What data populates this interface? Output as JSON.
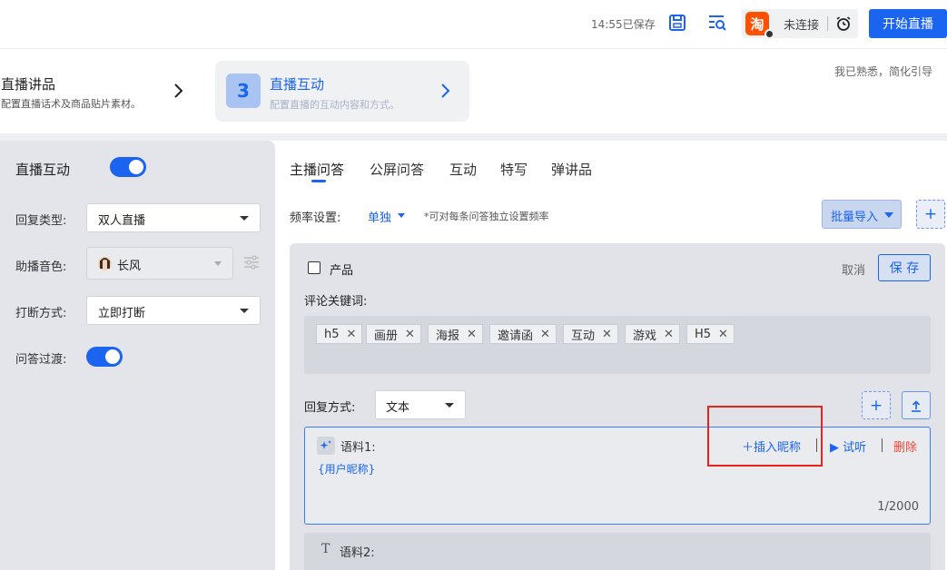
{
  "header": {
    "saved_status": "14:55已保存",
    "connection_platform": "淘",
    "connection_status": "未连接",
    "start_button": "开始直播"
  },
  "steps": {
    "step1_title": "直播讲品",
    "step1_desc": "配置直播话术及商品贴片素材。",
    "step2_number": "3",
    "step2_title": "直播互动",
    "step2_desc": "配置直播的互动内容和方式。",
    "familiar_link": "我已熟悉，简化引导"
  },
  "left_panel": {
    "main_label": "直播互动",
    "main_toggle": "on",
    "reply_type_label": "回复类型:",
    "reply_type_value": "双人直播",
    "voice_label": "助播音色:",
    "voice_value": "长风",
    "interrupt_label": "打断方式:",
    "interrupt_value": "立即打断",
    "qa_transition_label": "问答过渡:",
    "qa_transition_toggle": "on"
  },
  "tabs": [
    "主播问答",
    "公屏问答",
    "互动",
    "特写",
    "弹讲品"
  ],
  "active_tab": "主播问答",
  "frequency": {
    "label": "频率设置:",
    "value": "单独",
    "note": "*可对每条问答独立设置频率"
  },
  "batch_import": "批量导入",
  "add_symbol": "+",
  "qa_card": {
    "product_label": "产品",
    "cancel": "取消",
    "save": "保 存",
    "keyword_label": "评论关键词:",
    "keywords": [
      "h5",
      "画册",
      "海报",
      "邀请函",
      "互动",
      "游戏",
      "H5"
    ],
    "reply_mode_label": "回复方式:",
    "reply_mode_value": "文本",
    "corpus1_title": "语料1:",
    "corpus1_content": "{用户昵称}",
    "insert_nickname": "＋插入昵称",
    "try_listen": "▶ 试听",
    "delete": "删除",
    "counter": "1/2000",
    "corpus2_icon": "T",
    "corpus2_title": "语料2:"
  },
  "colors": {
    "primary": "#1b64f0",
    "danger": "#f04a3a",
    "highlight": "#e8231b",
    "taobao": "#ff5000"
  }
}
